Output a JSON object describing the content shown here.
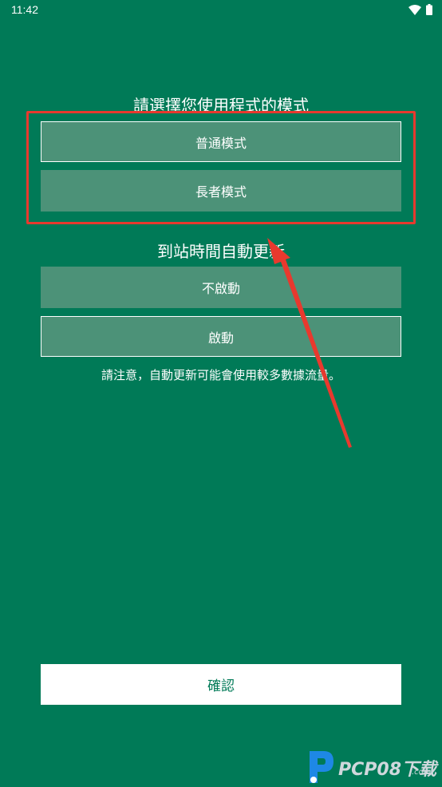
{
  "status_bar": {
    "time": "11:42",
    "icons": [
      "wifi-icon",
      "battery-icon"
    ]
  },
  "mode_section": {
    "title": "請選擇您使用程式的模式",
    "options": [
      {
        "label": "普通模式",
        "selected": true
      },
      {
        "label": "長者模式",
        "selected": false
      }
    ]
  },
  "update_section": {
    "title": "到站時間自動更新",
    "options": [
      {
        "label": "不啟動",
        "selected": false
      },
      {
        "label": "啟動",
        "selected": true
      }
    ],
    "notice": "請注意，自動更新可能會使用較多數據流量。"
  },
  "confirm": {
    "label": "確認"
  },
  "watermark": {
    "text": "PCP08",
    "suffix": "下载",
    "sub": ".com"
  },
  "colors": {
    "background": "#007a57",
    "button": "#4c9278",
    "annotation": "#e8392e",
    "confirm_text": "#007a57"
  }
}
